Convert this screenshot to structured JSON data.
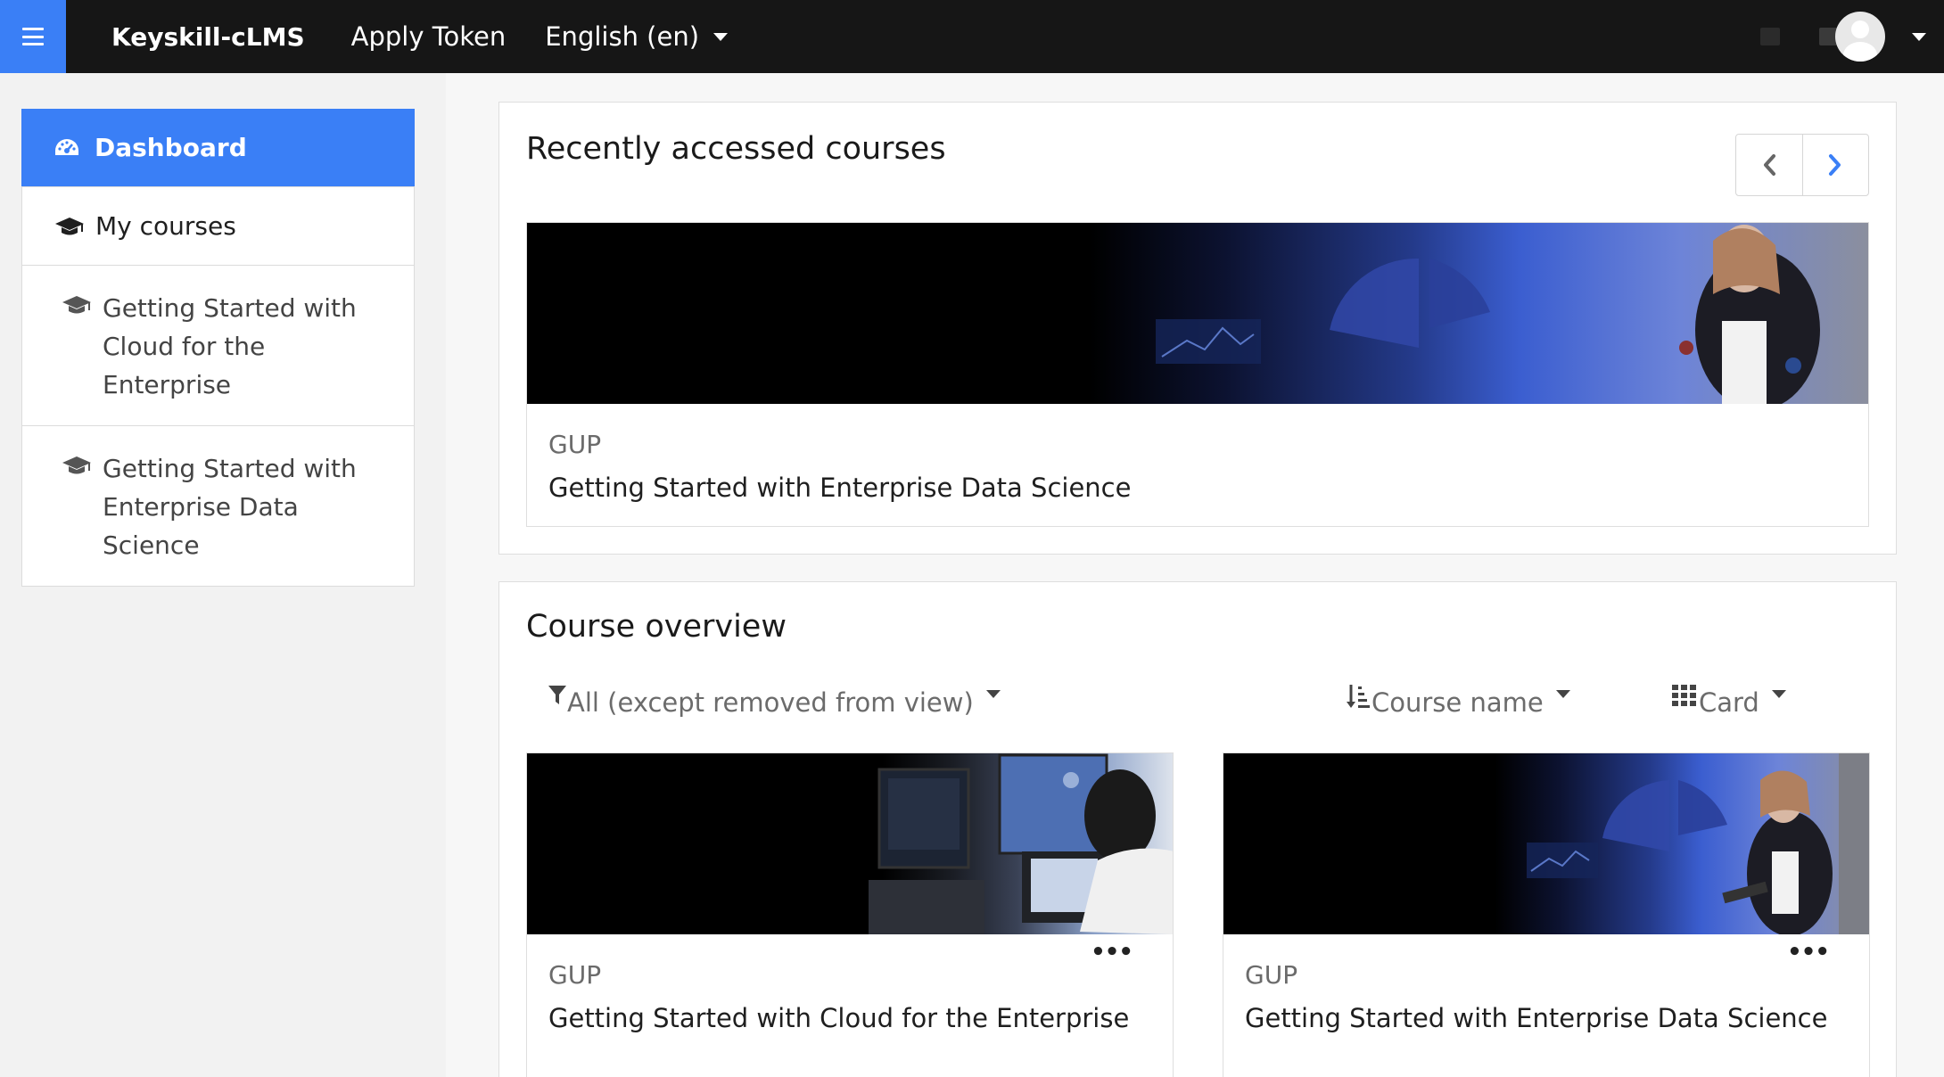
{
  "navbar": {
    "brand": "Keyskill-cLMS",
    "apply_token": "Apply Token",
    "language": "English ‎(en)‎",
    "icons": [
      "menu-icon",
      "notification-icon",
      "message-icon",
      "user-avatar",
      "caret-down-icon"
    ]
  },
  "sidebar": {
    "items": [
      {
        "label": "Dashboard",
        "icon": "dashboard-icon",
        "active": true
      },
      {
        "label": "My courses",
        "icon": "graduation-cap-icon"
      },
      {
        "label_line1": "Getting Started with",
        "label_line2": "Cloud for the Enterprise",
        "icon": "graduation-cap-icon"
      },
      {
        "label_line1": "Getting Started with",
        "label_line2": "Enterprise Data Science",
        "icon": "graduation-cap-icon"
      }
    ]
  },
  "recent": {
    "title": "Recently accessed courses",
    "prev_label": "‹",
    "next_label": "›",
    "course": {
      "category": "GUP",
      "name": "Getting Started with Enterprise Data Science"
    }
  },
  "overview": {
    "title": "Course overview",
    "filter_label": "All (except removed from view)",
    "sort_label": "Course name",
    "view_label": "Card",
    "courses": [
      {
        "category": "GUP",
        "name": "Getting Started with Cloud for the Enterprise",
        "menu": "•••"
      },
      {
        "category": "GUP",
        "name": "Getting Started with Enterprise Data Science",
        "menu": "•••"
      }
    ]
  },
  "colors": {
    "accent": "#3a7ff6",
    "navbar": "#161616"
  }
}
